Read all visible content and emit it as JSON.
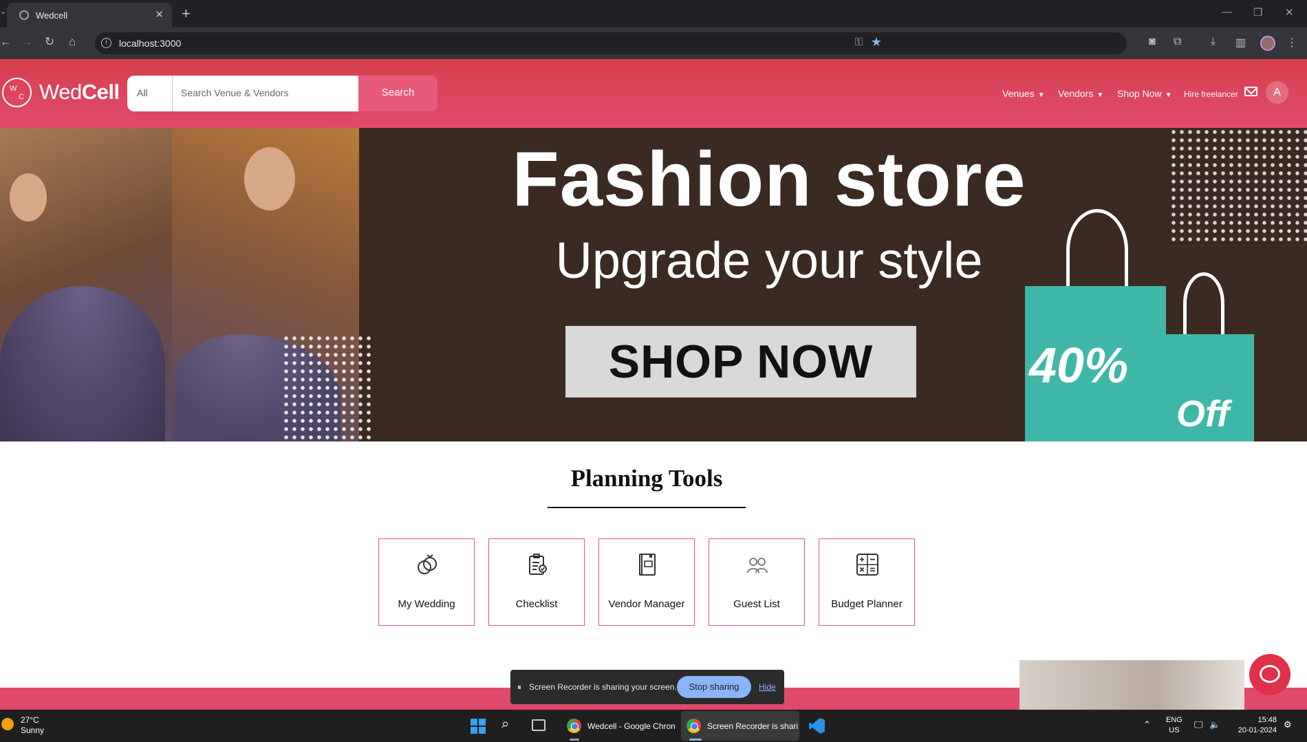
{
  "browser": {
    "tab_title": "Wedcell",
    "url": "localhost:3000"
  },
  "header": {
    "logo_initials": [
      "W",
      "C"
    ],
    "logo_text_light": "Wed",
    "logo_text_bold": "Cell",
    "search": {
      "category": "All",
      "placeholder": "Search Venue & Vendors",
      "button_label": "Search"
    },
    "nav": {
      "venues": "Venues",
      "vendors": "Vendors",
      "shop_now": "Shop Now",
      "hire_freelancer": "Hire freelancer"
    },
    "avatar_letter": "A"
  },
  "banner": {
    "headline": "Fashion store",
    "subline": "Upgrade your style",
    "cta": "SHOP NOW",
    "discount_value": "40%",
    "discount_word": "Off"
  },
  "planning": {
    "title": "Planning Tools",
    "tools": [
      {
        "label": "My Wedding",
        "icon": "rings-icon"
      },
      {
        "label": "Checklist",
        "icon": "checklist-icon"
      },
      {
        "label": "Vendor Manager",
        "icon": "vendor-book-icon"
      },
      {
        "label": "Guest List",
        "icon": "guests-icon"
      },
      {
        "label": "Budget Planner",
        "icon": "calculator-icon"
      }
    ]
  },
  "screenshare": {
    "message": "Screen Recorder is sharing your screen.",
    "stop_label": "Stop sharing",
    "hide_label": "Hide"
  },
  "taskbar": {
    "temperature": "27°C",
    "condition": "Sunny",
    "apps": [
      {
        "label": "Wedcell - Google Chron"
      },
      {
        "label": "Screen Recorder is shari"
      }
    ],
    "language": "ENG",
    "region": "US",
    "time": "15:48",
    "date": "20-01-2024"
  },
  "colors": {
    "brand_pink": "#e04a6a",
    "banner_brown": "#3b2a21",
    "bag_teal": "#3fb7a8"
  }
}
